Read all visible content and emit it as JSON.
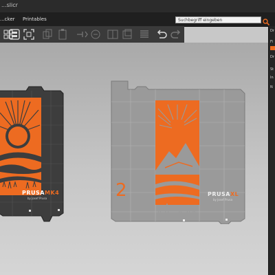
{
  "window": {
    "title": "...slicr"
  },
  "menubar": {
    "tabs": [
      {
        "label": "...cker"
      },
      {
        "label": "Printables"
      }
    ],
    "search_placeholder": "Suchbegriff eingeben"
  },
  "toolbar": {
    "buttons": [
      "arrange-icon",
      "layout-icon",
      "fit-icon",
      "copy-icon",
      "paste-icon",
      "add-icon",
      "remove-icon",
      "split-icon",
      "layers-icon",
      "variable-layer-icon",
      "undo-icon",
      "redo-icon"
    ]
  },
  "sidepanel": {
    "labels": [
      "Dr",
      "Fi",
      "Dr",
      "St",
      "In",
      "N"
    ]
  },
  "plates": {
    "left_brand": "PRUSA",
    "left_brand_suffix": "MK4",
    "left_by": "by Josef Prusa",
    "right_brand": "PRUSA",
    "right_brand_suffix": "XL",
    "right_by": "by Josef Prusa",
    "plate_number": "2"
  },
  "colors": {
    "accent": "#ed6b21",
    "plate_dark": "#3d3d3d",
    "plate_inactive": "#8f8f8f"
  }
}
